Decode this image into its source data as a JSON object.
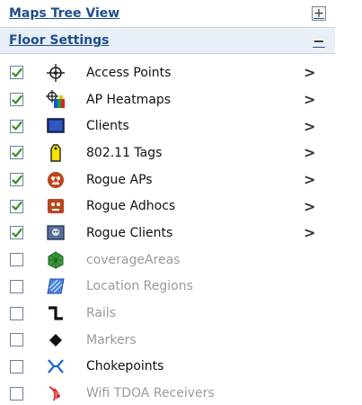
{
  "maps_tree_view": {
    "title": "Maps Tree View",
    "toggle": "+"
  },
  "floor_settings": {
    "title": "Floor Settings",
    "toggle": "−"
  },
  "layers": [
    {
      "label": "Access Points",
      "checked": true,
      "enabled": true,
      "has_chevron": true,
      "icon": "access-point-icon"
    },
    {
      "label": "AP Heatmaps",
      "checked": true,
      "enabled": true,
      "has_chevron": true,
      "icon": "heatmap-icon"
    },
    {
      "label": "Clients",
      "checked": true,
      "enabled": true,
      "has_chevron": true,
      "icon": "client-icon"
    },
    {
      "label": "802.11 Tags",
      "checked": true,
      "enabled": true,
      "has_chevron": true,
      "icon": "tag-icon"
    },
    {
      "label": "Rogue APs",
      "checked": true,
      "enabled": true,
      "has_chevron": true,
      "icon": "rogue-ap-icon"
    },
    {
      "label": "Rogue Adhocs",
      "checked": true,
      "enabled": true,
      "has_chevron": true,
      "icon": "rogue-adhoc-icon"
    },
    {
      "label": "Rogue Clients",
      "checked": true,
      "enabled": true,
      "has_chevron": true,
      "icon": "rogue-client-icon"
    },
    {
      "label": "coverageAreas",
      "checked": false,
      "enabled": false,
      "has_chevron": false,
      "icon": "coverage-area-icon"
    },
    {
      "label": "Location Regions",
      "checked": false,
      "enabled": false,
      "has_chevron": false,
      "icon": "location-region-icon"
    },
    {
      "label": "Rails",
      "checked": false,
      "enabled": false,
      "has_chevron": false,
      "icon": "rail-icon"
    },
    {
      "label": "Markers",
      "checked": false,
      "enabled": false,
      "has_chevron": false,
      "icon": "marker-icon"
    },
    {
      "label": "Chokepoints",
      "checked": false,
      "enabled": true,
      "has_chevron": false,
      "icon": "chokepoint-icon"
    },
    {
      "label": "Wifi TDOA Receivers",
      "checked": false,
      "enabled": false,
      "has_chevron": false,
      "icon": "wifi-tdoa-receiver-icon"
    }
  ],
  "chevron_glyph": ">",
  "figure_id": "227620",
  "colors": {
    "header_text": "#1f4e8c",
    "header_band": "#e8eff6",
    "check": "#2e8b1e",
    "dim_text": "#9a9a9a"
  }
}
